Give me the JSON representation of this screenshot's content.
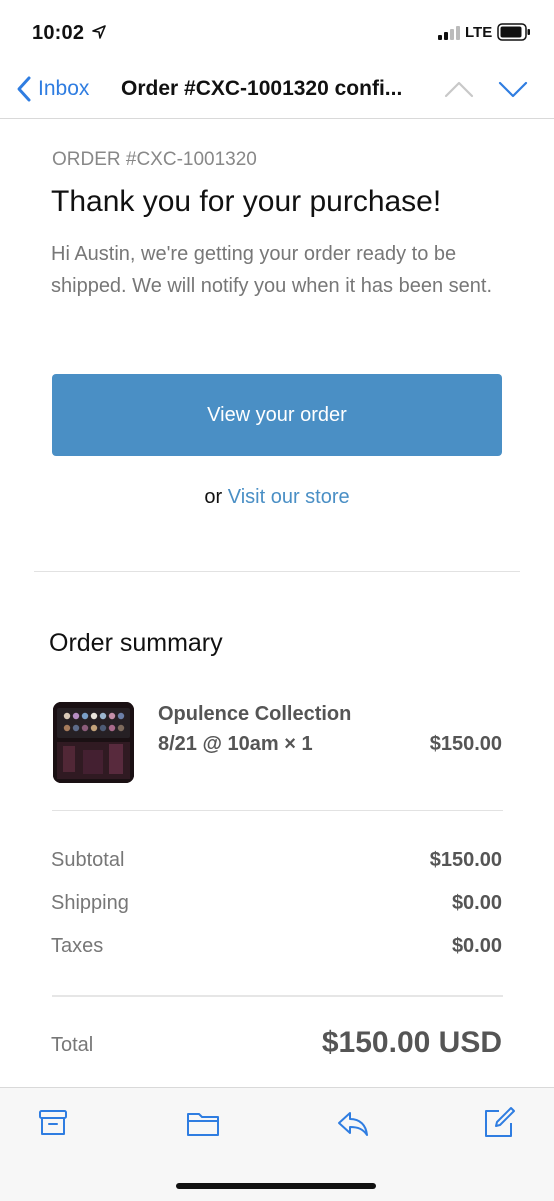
{
  "status_bar": {
    "time": "10:02",
    "network": "LTE",
    "icons": [
      "location-arrow-icon",
      "signal-icon",
      "battery-icon"
    ]
  },
  "nav": {
    "back_label": "Inbox",
    "title": "Order #CXC-1001320 confi...",
    "icons": [
      "chevron-left-icon",
      "chevron-up-icon",
      "chevron-down-icon"
    ]
  },
  "email": {
    "order_number": "ORDER #CXC-1001320",
    "heading": "Thank you for your purchase!",
    "intro": "Hi Austin, we're getting your order ready to be shipped. We will notify you when it has been sent.",
    "primary_button": "View your order",
    "or_text": "or",
    "store_link": "Visit our store",
    "summary_title": "Order summary",
    "item": {
      "name": "Opulence Collection",
      "variant": "8/21 @ 10am × 1",
      "price": "$150.00"
    },
    "rows": [
      {
        "label": "Subtotal",
        "value": "$150.00"
      },
      {
        "label": "Shipping",
        "value": "$0.00"
      },
      {
        "label": "Taxes",
        "value": "$0.00"
      }
    ],
    "total": {
      "label": "Total",
      "value": "$150.00 USD"
    }
  },
  "toolbar": {
    "icons": [
      "archive-icon",
      "folder-icon",
      "reply-icon",
      "compose-icon"
    ]
  },
  "colors": {
    "accent": "#2f7de1",
    "button": "#4a8fc5",
    "muted_text": "#777777"
  }
}
